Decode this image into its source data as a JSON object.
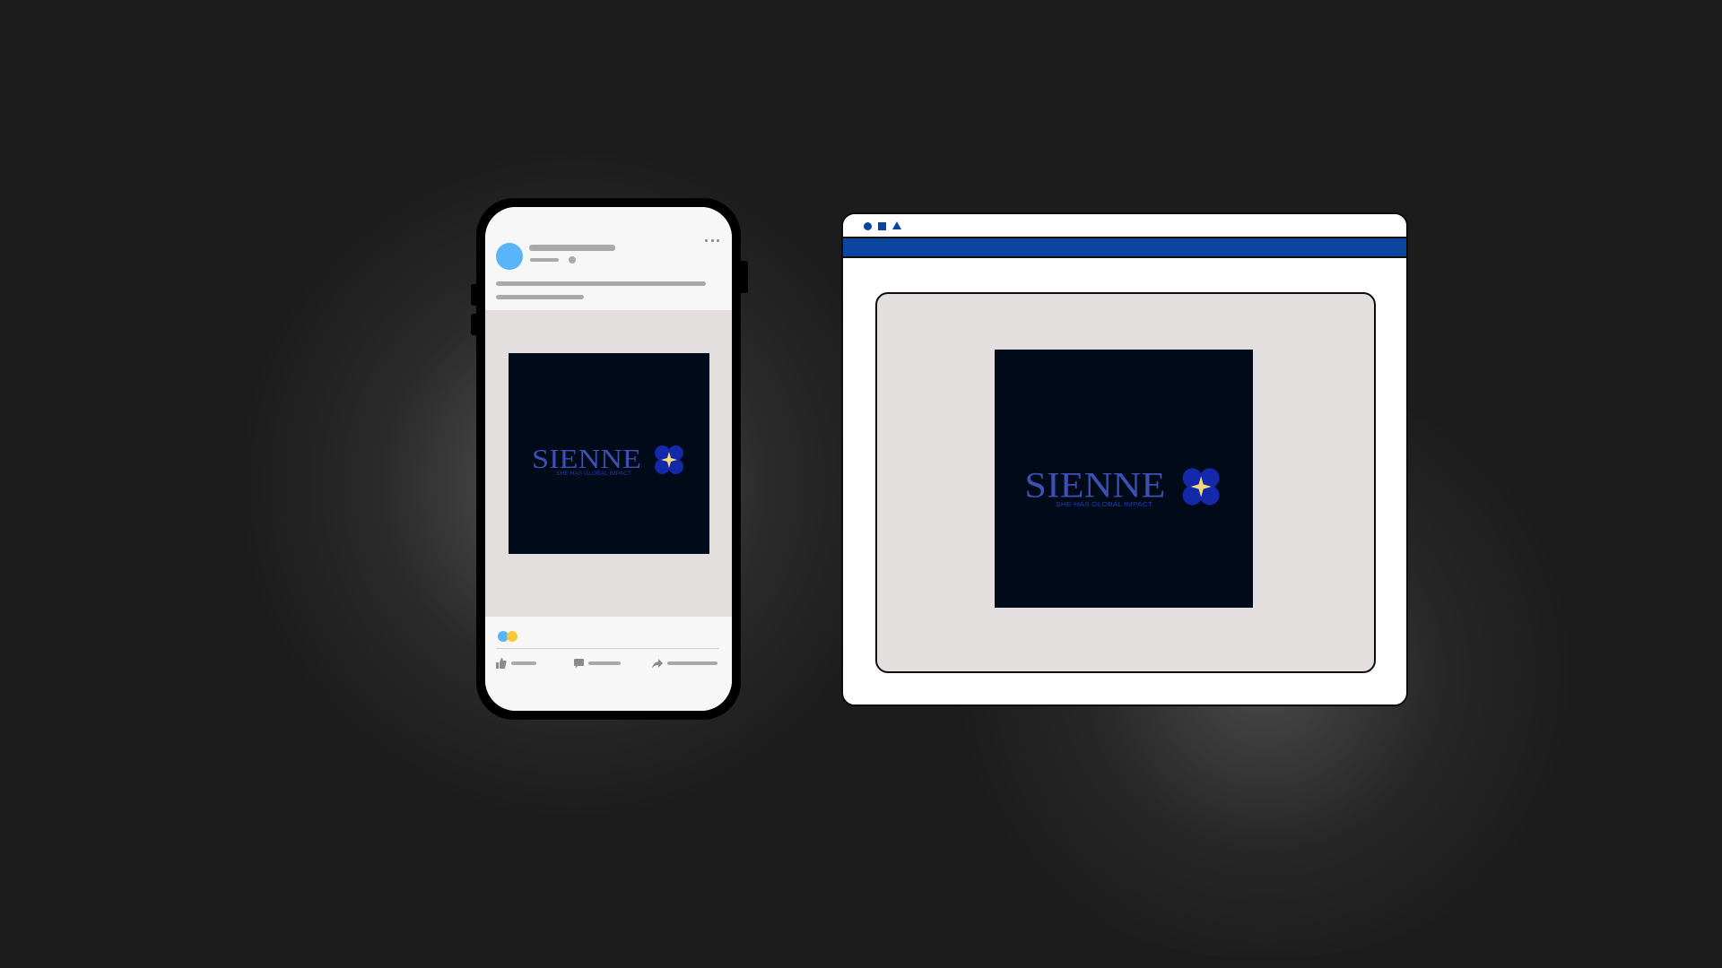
{
  "ad": {
    "brand_name": "SIENNE",
    "tagline": "SHE HAS GLOBAL IMPACT",
    "icon": "four-petal-flower-with-star-icon"
  },
  "colors": {
    "background": "#1c1c1c",
    "ad_background": "#000a19",
    "logo_text": "#3c50b4",
    "tagline_text": "#1e3cb4",
    "petal": "#1428aa",
    "star": "#f5dc7a",
    "browser_accent": "#0a46a0",
    "placeholder_gray": "#a9a9a9",
    "media_area": "#e3dfdf",
    "avatar": "#5ab4f8",
    "reaction_like": "#5ab4f8",
    "reaction_love": "#f6c83a"
  },
  "phone_post": {
    "avatar_icon": "avatar-circle",
    "more_icon": "ellipsis-icon",
    "actions": [
      {
        "icon": "thumbs-up-icon"
      },
      {
        "icon": "comment-icon"
      },
      {
        "icon": "share-arrow-icon"
      }
    ]
  },
  "browser": {
    "window_controls": [
      "circle-icon",
      "square-icon",
      "triangle-icon"
    ]
  }
}
